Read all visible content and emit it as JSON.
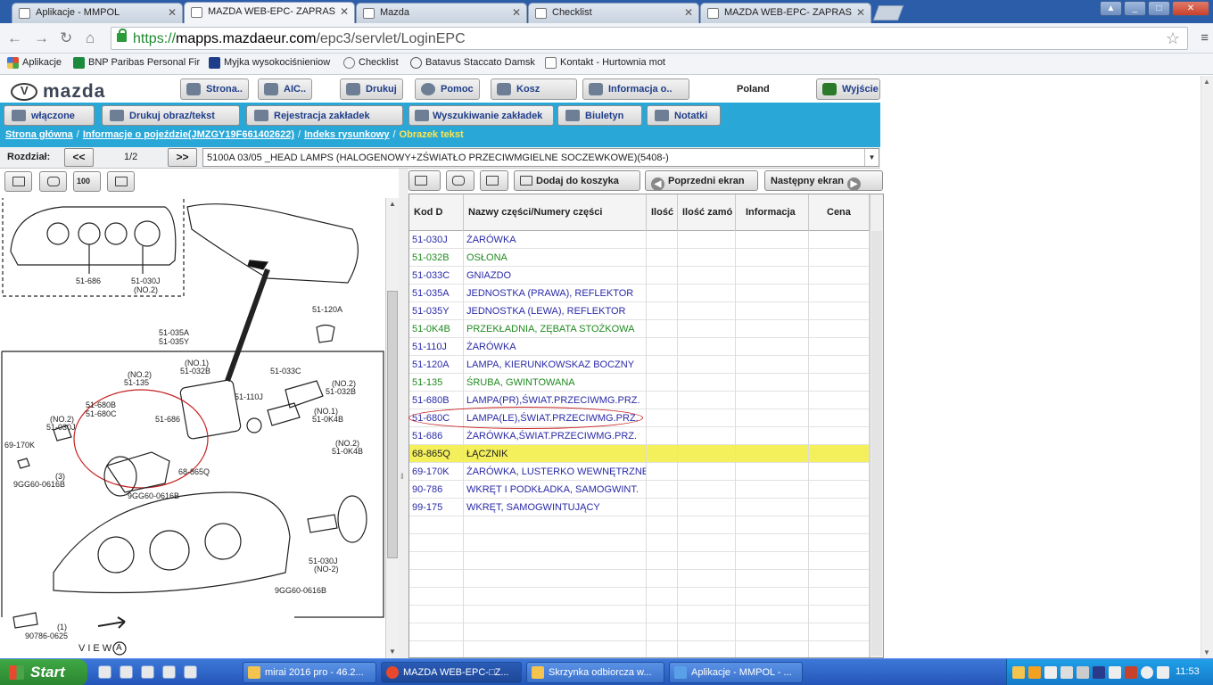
{
  "browser": {
    "tabs": [
      {
        "label": "Aplikacje - MMPOL"
      },
      {
        "label": "MAZDA WEB-EPC-  ZAPRAS"
      },
      {
        "label": "Mazda"
      },
      {
        "label": "Checklist"
      },
      {
        "label": "MAZDA WEB-EPC-  ZAPRAS"
      }
    ],
    "url_scheme": "https://",
    "url_host": "mapps.mazdaeur.com",
    "url_path": "/epc3/servlet/LoginEPC",
    "bookmarks": [
      {
        "label": "Aplikacje"
      },
      {
        "label": "BNP Paribas Personal Fir"
      },
      {
        "label": "Myjka wysokociśnieniow"
      },
      {
        "label": "Checklist"
      },
      {
        "label": "Batavus Staccato Damsk"
      },
      {
        "label": "Kontakt - Hurtownia mot"
      }
    ]
  },
  "app": {
    "logo_text": "mazda",
    "header_buttons": [
      {
        "label": "Strona.."
      },
      {
        "label": "AIC.."
      },
      {
        "label": "Drukuj"
      },
      {
        "label": "Pomoc"
      },
      {
        "label": "Kosz"
      },
      {
        "label": "Informacja o.."
      }
    ],
    "country": "Poland",
    "exit_label": "Wyjście",
    "menu_buttons": [
      {
        "label": "włączone"
      },
      {
        "label": "Drukuj obraz/tekst"
      },
      {
        "label": "Rejestracja zakładek"
      },
      {
        "label": "Wyszukiwanie zakładek"
      },
      {
        "label": "Biuletyn"
      },
      {
        "label": "Notatki"
      }
    ],
    "breadcrumb": {
      "home": "Strona główna",
      "vehicle": "Informacje o pojeździe(JMZGY19F661402622)",
      "index": "Indeks rysunkowy",
      "current": "Obrazek tekst"
    },
    "chapter": {
      "label": "Rozdział:",
      "prev": "<<",
      "page": "1/2",
      "next": ">>",
      "selected": "5100A 03/05 _HEAD LAMPS (HALOGENOWY+ZŚWIATŁO PRZECIWMGIELNE SOCZEWKOWE)(5408-)"
    },
    "left_tools": {
      "zoom_label": "100"
    },
    "right_tools": {
      "add_cart": "Dodaj do koszyka",
      "prev_screen": "Poprzedni ekran",
      "next_screen": "Następny ekran"
    },
    "diagram_labels": {
      "l1": "51-686",
      "l2": "51-030J",
      "l3": "(NO.2)",
      "l4": "51-120A",
      "l5": "51-035A",
      "l6": "51-035Y",
      "l7": "(NO.1)",
      "l8": "51-032B",
      "l9": "(NO.2)",
      "l10": "51-135",
      "l11": "51-033C",
      "l12": "(NO.2)",
      "l13": "51-032B",
      "l14": "51-680B",
      "l15": "51-680C",
      "l16": "51-110J",
      "l17": "(NO.1)",
      "l18": "51-0K4B",
      "l19": "(NO.2)",
      "l20": "51-030J",
      "l21": "51-686",
      "l22": "69-170K",
      "l23": "(3)",
      "l24": "9GG60-0616B",
      "l25": "68-865Q",
      "l26": "9GG60-0616B",
      "l27": "(NO.2)",
      "l28": "51-0K4B",
      "l29": "51-030J",
      "l30": "(NO-2)",
      "l31": "9GG60-0616B",
      "l32": "(1)",
      "l33": "90786-0625",
      "l34": "VIEW",
      "l35": "A"
    },
    "parts_table": {
      "headers": [
        "Kod D",
        "Nazwy części/Numery części",
        "Ilość",
        "Ilość zamó",
        "Informacja",
        "Cena"
      ],
      "rows": [
        {
          "code": "51-030J",
          "name": "ŻARÓWKA",
          "color": "#2a2aa8"
        },
        {
          "code": "51-032B",
          "name": "OSŁONA",
          "color": "#1f8a1f"
        },
        {
          "code": "51-033C",
          "name": "GNIAZDO",
          "color": "#2a2aa8"
        },
        {
          "code": "51-035A",
          "name": "JEDNOSTKA (PRAWA), REFLEKTOR",
          "color": "#2a2aa8"
        },
        {
          "code": "51-035Y",
          "name": "JEDNOSTKA (LEWA), REFLEKTOR",
          "color": "#2a2aa8"
        },
        {
          "code": "51-0K4B",
          "name": "PRZEKŁADNIA, ZĘBATA STOŻKOWA",
          "color": "#1f8a1f"
        },
        {
          "code": "51-110J",
          "name": "ŻARÓWKA",
          "color": "#2a2aa8"
        },
        {
          "code": "51-120A",
          "name": "LAMPA, KIERUNKOWSKAZ BOCZNY",
          "color": "#2a2aa8"
        },
        {
          "code": "51-135",
          "name": "ŚRUBA, GWINTOWANA",
          "color": "#1f8a1f"
        },
        {
          "code": "51-680B",
          "name": "LAMPA(PR),ŚWIAT.PRZECIWMG.PRZ.",
          "color": "#2a2aa8"
        },
        {
          "code": "51-680C",
          "name": "LAMPA(LE),ŚWIAT.PRZECIWMG.PRZ.",
          "color": "#2a2aa8"
        },
        {
          "code": "51-686",
          "name": "ŻARÓWKA,ŚWIAT.PRZECIWMG.PRZ.",
          "color": "#2a2aa8"
        },
        {
          "code": "68-865Q",
          "name": "ŁĄCZNIK",
          "color": "#222222",
          "selected": true
        },
        {
          "code": "69-170K",
          "name": "ŻARÓWKA, LUSTERKO WEWNĘTRZNE",
          "color": "#2a2aa8"
        },
        {
          "code": "90-786",
          "name": "WKRĘT I PODKŁADKA, SAMOGWINT.",
          "color": "#2a2aa8"
        },
        {
          "code": "99-175",
          "name": "WKRĘT, SAMOGWINTUJĄCY",
          "color": "#2a2aa8"
        }
      ]
    }
  },
  "taskbar": {
    "start": "Start",
    "tasks": [
      {
        "label": "mirai 2016 pro - 46.2..."
      },
      {
        "label": "MAZDA WEB-EPC-□Z..."
      },
      {
        "label": "Skrzynka odbiorcza w..."
      },
      {
        "label": "Aplikacje - MMPOL - ..."
      }
    ],
    "clock": "11:53"
  }
}
